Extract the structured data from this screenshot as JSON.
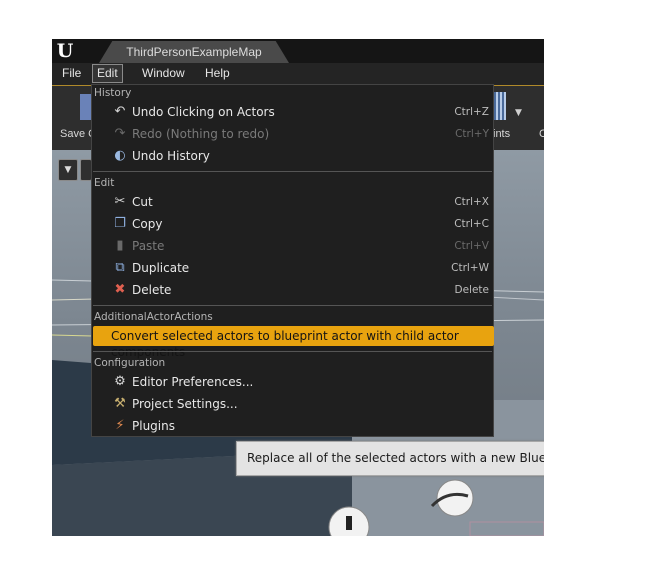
{
  "app": {
    "logo_icon": "unreal-engine-logo-icon",
    "map_tab": "ThirdPersonExampleMap"
  },
  "menubar": {
    "items": [
      "File",
      "Edit",
      "Window",
      "Help"
    ],
    "active": "Edit"
  },
  "toolbar": {
    "save_label": "Save C",
    "blueprints_label": "ints",
    "next_label": "C"
  },
  "edit_menu": {
    "sections": [
      {
        "header": "History",
        "items": [
          {
            "label": "Undo Clicking on Actors",
            "shortcut": "Ctrl+Z",
            "icon": "undo-icon",
            "enabled": true
          },
          {
            "label": "Redo (Nothing to redo)",
            "shortcut": "Ctrl+Y",
            "icon": "redo-icon",
            "enabled": false
          },
          {
            "label": "Undo History",
            "shortcut": "",
            "icon": "undo-history-icon",
            "enabled": true
          }
        ]
      },
      {
        "header": "Edit",
        "items": [
          {
            "label": "Cut",
            "shortcut": "Ctrl+X",
            "icon": "scissors-icon",
            "enabled": true
          },
          {
            "label": "Copy",
            "shortcut": "Ctrl+C",
            "icon": "copy-icon",
            "enabled": true
          },
          {
            "label": "Paste",
            "shortcut": "Ctrl+V",
            "icon": "paste-icon",
            "enabled": false
          },
          {
            "label": "Duplicate",
            "shortcut": "Ctrl+W",
            "icon": "duplicate-icon",
            "enabled": true
          },
          {
            "label": "Delete",
            "shortcut": "Delete",
            "icon": "delete-icon",
            "enabled": true
          }
        ]
      },
      {
        "header": "AdditionalActorActions",
        "items": [
          {
            "label": "Convert selected actors to blueprint actor with child actor components",
            "shortcut": "",
            "icon": "",
            "enabled": true,
            "highlighted": true
          }
        ]
      },
      {
        "header": "Configuration",
        "items": [
          {
            "label": "Editor Preferences...",
            "shortcut": "",
            "icon": "editor-preferences-icon",
            "enabled": true
          },
          {
            "label": "Project Settings...",
            "shortcut": "",
            "icon": "project-settings-icon",
            "enabled": true
          },
          {
            "label": "Plugins",
            "shortcut": "",
            "icon": "plugins-icon",
            "enabled": true
          }
        ]
      }
    ]
  },
  "tooltip": {
    "text": "Replace all of the selected actors with a new Blueprint C"
  },
  "colors": {
    "highlight": "#e8a30f",
    "menu_bg": "#1f1f1f",
    "menubar_bg": "#242424",
    "title_bg": "#151515"
  }
}
